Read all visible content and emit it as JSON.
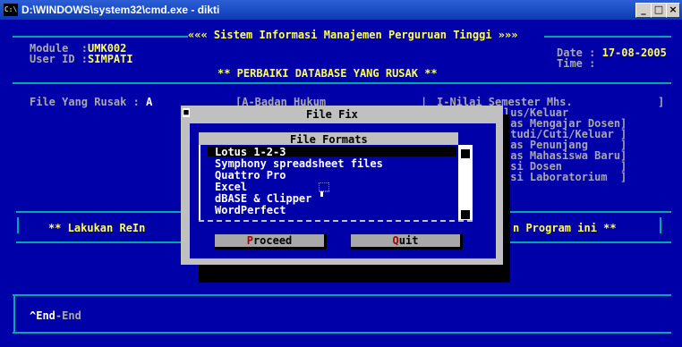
{
  "window": {
    "title": "D:\\WINDOWS\\system32\\cmd.exe - dikti",
    "icon_text": "C:\\",
    "buttons": [
      "_",
      "□",
      "×"
    ]
  },
  "header": {
    "app_title": "««« Sistem Informasi Manajemen Perguruan Tinggi »»»",
    "module_label": "Module  :",
    "module_value": "UMK002",
    "user_label": "User ID :",
    "user_value": "SIMPATI",
    "date_label": "Date :",
    "date_value": "17-08-2005",
    "time_label": "Time :",
    "time_value": "",
    "subtitle": "** PERBAIKI DATABASE YANG RUSAK **"
  },
  "main": {
    "file_label": "File Yang Rusak :",
    "file_value": "A",
    "left_options": [
      "[A-Badan Hukum"
    ],
    "right_options": [
      "I-Nilai Semester Mhs.",
      "lus/Keluar",
      "tas Mengajar Dosen]",
      "Studi/Cuti/Keluar ]",
      "tas Penunjang     ]",
      "tas Mahasiswa Baru]",
      "asi Dosen         ]",
      "ksi Laboratorium  ]"
    ],
    "bracket_col": [
      "]",
      "]",
      "]",
      "]",
      "]",
      "]",
      "]",
      "]"
    ],
    "message_left": "** Lakukan ReIn",
    "message_right": "n Program ini **"
  },
  "footer": {
    "hint_key": "^End",
    "hint_text": "-End"
  },
  "dialog": {
    "title": "File Fix",
    "list_header": "File Formats",
    "items": [
      "Lotus 1-2-3",
      "Symphony spreadsheet files",
      "Quattro Pro",
      "Excel",
      "dBASE & Clipper",
      "WordPerfect"
    ],
    "selected_index": 0,
    "proceed_hot": "P",
    "proceed_rest": "roceed",
    "quit_hot": "Q",
    "quit_rest": "uit"
  },
  "colors": {
    "console_bg": "#0000a8",
    "frame": "#00a8a8",
    "highlight": "#ffff54",
    "dialog_gray": "#c0c0c0",
    "hotkey_red": "#a80000"
  },
  "icons": [
    "cmd-app-icon",
    "minimize-icon",
    "maximize-icon",
    "close-icon",
    "mouse-cursor-icon"
  ]
}
